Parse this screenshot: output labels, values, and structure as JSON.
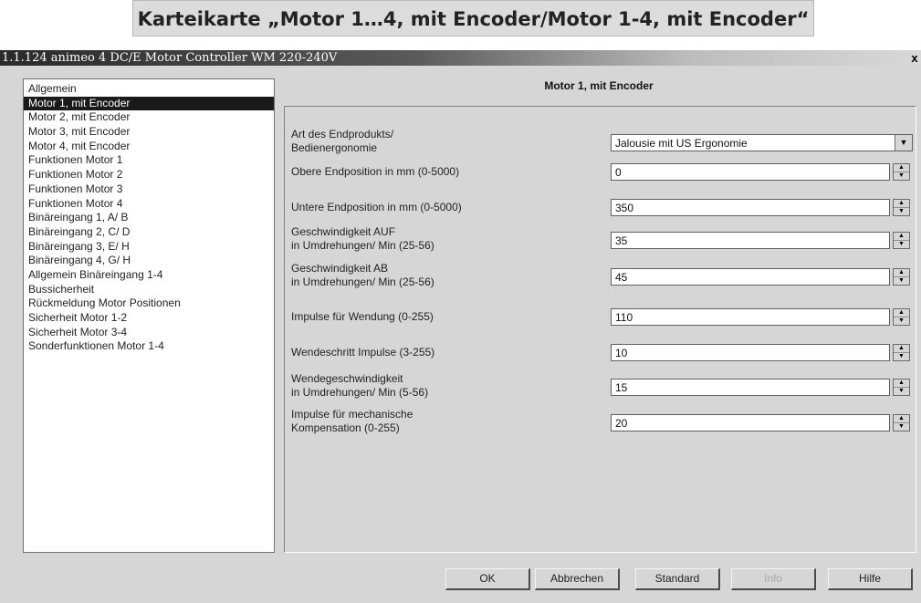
{
  "caption": "Karteikarte „Motor 1…4, mit Encoder/Motor 1-4, mit Encoder“",
  "window": {
    "title": "1.1.124 animeo 4 DC/E Motor Controller WM 220-240V",
    "close": "x"
  },
  "nav": {
    "selected_index": 1,
    "items": [
      {
        "label": "Allgemein"
      },
      {
        "label": "Motor 1, mit Encoder"
      },
      {
        "label": "Motor 2, mit Encoder"
      },
      {
        "label": "Motor 3, mit Encoder"
      },
      {
        "label": "Motor 4, mit Encoder"
      },
      {
        "label": "Funktionen Motor 1"
      },
      {
        "label": "Funktionen Motor 2"
      },
      {
        "label": "Funktionen Motor 3"
      },
      {
        "label": "Funktionen Motor 4"
      },
      {
        "label": "Binäreingang 1, A/ B"
      },
      {
        "label": "Binäreingang 2, C/ D"
      },
      {
        "label": "Binäreingang 3, E/ H"
      },
      {
        "label": "Binäreingang 4, G/ H"
      },
      {
        "label": "Allgemein Binäreingang 1-4"
      },
      {
        "label": "Bussicherheit"
      },
      {
        "label": "Rückmeldung Motor Positionen"
      },
      {
        "label": "Sicherheit Motor 1-2"
      },
      {
        "label": "Sicherheit Motor 3-4"
      },
      {
        "label": "Sonderfunktionen Motor 1-4"
      }
    ]
  },
  "page": {
    "title": "Motor 1, mit Encoder",
    "params": [
      {
        "label": "Art des Endprodukts/\nBedienergonomie",
        "value": "Jalousie mit US Ergonomie",
        "control": "dropdown"
      },
      {
        "label": "Obere Endposition in mm (0-5000)",
        "value": "0",
        "control": "spin"
      },
      {
        "label": "Untere Endposition in mm (0-5000)",
        "value": "350",
        "control": "spin"
      },
      {
        "label": "Geschwindigkeit AUF\nin Umdrehungen/ Min (25-56)",
        "value": "35",
        "control": "spin"
      },
      {
        "label": "Geschwindigkeit AB\nin Umdrehungen/ Min (25-56)",
        "value": "45",
        "control": "spin"
      },
      {
        "label": "Impulse für Wendung (0-255)",
        "value": "110",
        "control": "spin"
      },
      {
        "label": "Wendeschritt Impulse (3-255)",
        "value": "10",
        "control": "spin"
      },
      {
        "label": "Wendegeschwindigkeit\nin Umdrehungen/ Min (5-56)",
        "value": "15",
        "control": "spin"
      },
      {
        "label": "Impulse  für mechanische\nKompensation (0-255)",
        "value": "20",
        "control": "spin"
      }
    ]
  },
  "buttons": {
    "ok": "OK",
    "cancel": "Abbrechen",
    "standard": "Standard",
    "info": "Info",
    "help": "Hilfe",
    "info_disabled": true
  },
  "icons": {
    "spin_up": "▲",
    "spin_down": "▼",
    "dropdown": "▼"
  }
}
